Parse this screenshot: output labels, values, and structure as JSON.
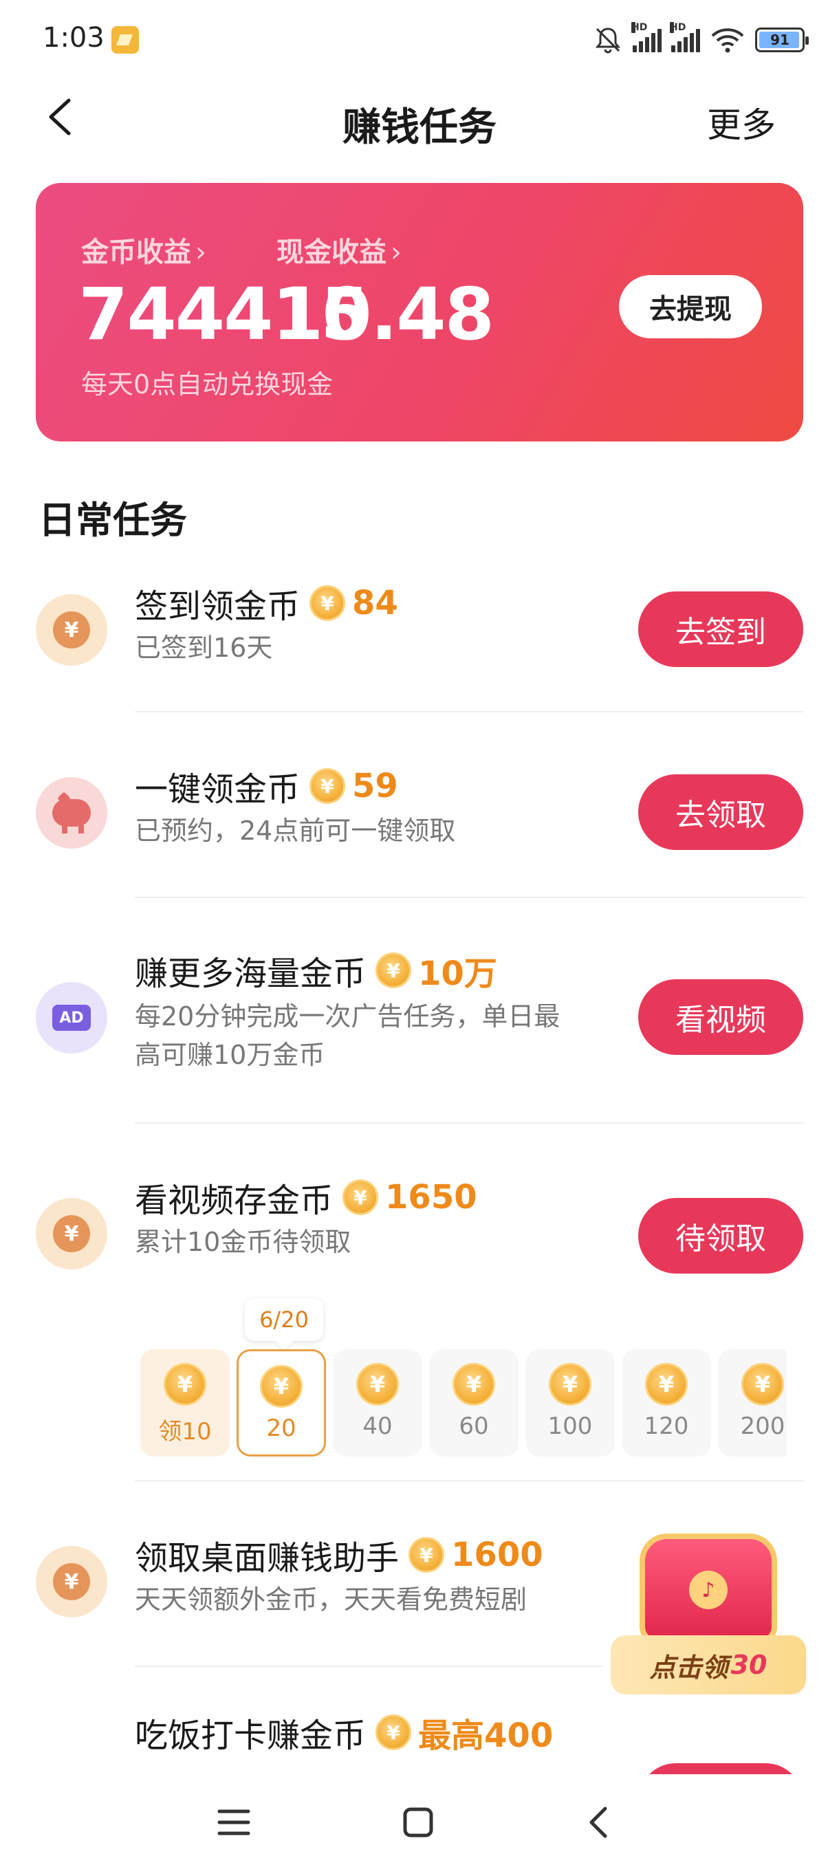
{
  "status": {
    "time": "1:03",
    "battery": "91",
    "network1": "HD",
    "network2": "HD"
  },
  "header": {
    "title": "赚钱任务",
    "more": "更多"
  },
  "earnings": {
    "coin_label": "金币收益",
    "coin_value": "744415",
    "cash_label": "现金收益",
    "cash_value": "10.48",
    "withdraw": "去提现",
    "note": "每天0点自动兑换现金"
  },
  "section_title": "日常任务",
  "tasks": [
    {
      "title": "签到领金币",
      "reward": "84",
      "desc": "已签到16天",
      "button": "去签到"
    },
    {
      "title": "一键领金币",
      "reward": "59",
      "desc": "已预约，24点前可一键领取",
      "button": "去领取"
    },
    {
      "title": "赚更多海量金币",
      "reward": "10万",
      "desc1": "每20分钟完成一次广告任务，单日最",
      "desc2": "高可赚10万金币",
      "button": "看视频",
      "icon_text": "AD"
    },
    {
      "title": "看视频存金币",
      "reward": "1650",
      "desc": "累计10金币待领取",
      "button": "待领取"
    },
    {
      "title": "领取桌面赚钱助手",
      "reward": "1600",
      "desc": "天天领额外金币，天天看免费短剧"
    },
    {
      "title": "吃饭打卡赚金币",
      "reward": "最高400"
    }
  ],
  "progress": {
    "tag": "6/20",
    "chips": [
      "领10",
      "20",
      "40",
      "60",
      "100",
      "120",
      "200"
    ]
  },
  "promo": {
    "text": "点击领",
    "amount": "30"
  },
  "icons": {
    "coin_symbol": "¥"
  }
}
